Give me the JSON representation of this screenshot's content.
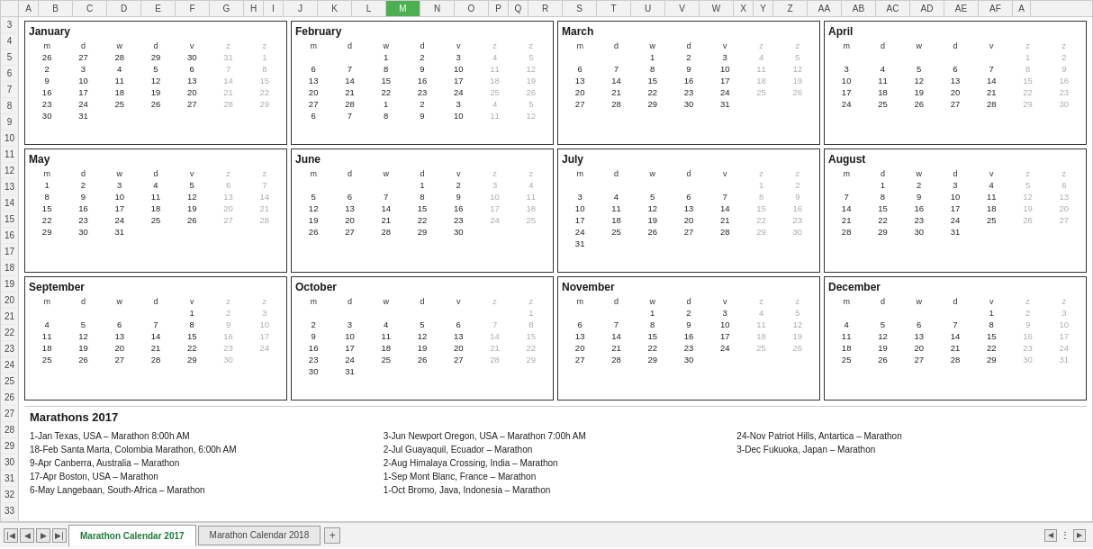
{
  "title": "Marathon Calendar 2017",
  "tabs": {
    "active": "Marathon Calendar 2017",
    "inactive": "Marathon Calendar 2018",
    "add_label": "+"
  },
  "col_headers": [
    "A",
    "B",
    "C",
    "D",
    "E",
    "F",
    "G",
    "H",
    "I",
    "J",
    "K",
    "L",
    "M",
    "N",
    "O",
    "P",
    "Q",
    "R",
    "S",
    "T",
    "U",
    "V",
    "W",
    "X",
    "Y",
    "Z",
    "AA",
    "AB",
    "AC",
    "AD",
    "AE",
    "AF",
    "A"
  ],
  "months": [
    {
      "name": "January",
      "days_header": [
        "m",
        "d",
        "w",
        "d",
        "v",
        "z",
        "z"
      ],
      "weeks": [
        [
          "26",
          "27",
          "28",
          "29",
          "30",
          "31",
          "1"
        ],
        [
          "2",
          "3",
          "4",
          "5",
          "6",
          "7",
          "8"
        ],
        [
          "9",
          "10",
          "11",
          "12",
          "13",
          "14",
          "15"
        ],
        [
          "16",
          "17",
          "18",
          "19",
          "20",
          "21",
          "22"
        ],
        [
          "23",
          "24",
          "25",
          "26",
          "27",
          "28",
          "29"
        ],
        [
          "30",
          "31",
          "",
          "",
          "",
          "",
          ""
        ]
      ],
      "weekends": [
        6,
        7
      ]
    },
    {
      "name": "February",
      "days_header": [
        "m",
        "d",
        "w",
        "d",
        "v",
        "z",
        "z"
      ],
      "weeks": [
        [
          "",
          "",
          "1",
          "2",
          "3",
          "4",
          "5"
        ],
        [
          "6",
          "7",
          "8",
          "9",
          "10",
          "11",
          "12"
        ],
        [
          "13",
          "14",
          "15",
          "16",
          "17",
          "18",
          "19"
        ],
        [
          "20",
          "21",
          "22",
          "23",
          "24",
          "25",
          "26"
        ],
        [
          "27",
          "28",
          "1",
          "2",
          "3",
          "4",
          "5"
        ],
        [
          "6",
          "7",
          "8",
          "9",
          "10",
          "11",
          "12"
        ]
      ],
      "weekends": [
        6,
        7
      ]
    },
    {
      "name": "March",
      "days_header": [
        "m",
        "d",
        "w",
        "d",
        "v",
        "z",
        "z"
      ],
      "weeks": [
        [
          "",
          "",
          "1",
          "2",
          "3",
          "4",
          "5"
        ],
        [
          "6",
          "7",
          "8",
          "9",
          "10",
          "11",
          "12"
        ],
        [
          "13",
          "14",
          "15",
          "16",
          "17",
          "18",
          "19"
        ],
        [
          "20",
          "21",
          "22",
          "23",
          "24",
          "25",
          "26"
        ],
        [
          "27",
          "28",
          "29",
          "30",
          "31",
          "",
          ""
        ]
      ],
      "weekends": [
        6,
        7
      ]
    },
    {
      "name": "April",
      "days_header": [
        "m",
        "d",
        "w",
        "d",
        "v",
        "z",
        "z"
      ],
      "weeks": [
        [
          "",
          "",
          "",
          "",
          "",
          "1",
          "2"
        ],
        [
          "3",
          "4",
          "5",
          "6",
          "7",
          "8",
          "9"
        ],
        [
          "10",
          "11",
          "12",
          "13",
          "14",
          "15",
          "16"
        ],
        [
          "17",
          "18",
          "19",
          "20",
          "21",
          "22",
          "23"
        ],
        [
          "24",
          "25",
          "26",
          "27",
          "28",
          "29",
          "30"
        ]
      ],
      "weekends": [
        6,
        7
      ]
    },
    {
      "name": "May",
      "days_header": [
        "m",
        "d",
        "w",
        "d",
        "v",
        "z",
        "z"
      ],
      "weeks": [
        [
          "1",
          "2",
          "3",
          "4",
          "5",
          "6",
          "7"
        ],
        [
          "8",
          "9",
          "10",
          "11",
          "12",
          "13",
          "14"
        ],
        [
          "15",
          "16",
          "17",
          "18",
          "19",
          "20",
          "21"
        ],
        [
          "22",
          "23",
          "24",
          "25",
          "26",
          "27",
          "28"
        ],
        [
          "29",
          "30",
          "31",
          "",
          "",
          "",
          ""
        ]
      ],
      "weekends": [
        6,
        7
      ]
    },
    {
      "name": "June",
      "days_header": [
        "m",
        "d",
        "w",
        "d",
        "v",
        "z",
        "z"
      ],
      "weeks": [
        [
          "",
          "",
          "",
          "1",
          "2",
          "3",
          "4"
        ],
        [
          "5",
          "6",
          "7",
          "8",
          "9",
          "10",
          "11"
        ],
        [
          "12",
          "13",
          "14",
          "15",
          "16",
          "17",
          "18"
        ],
        [
          "19",
          "20",
          "21",
          "22",
          "23",
          "24",
          "25"
        ],
        [
          "26",
          "27",
          "28",
          "29",
          "30",
          "",
          ""
        ]
      ],
      "weekends": [
        6,
        7
      ]
    },
    {
      "name": "July",
      "days_header": [
        "m",
        "d",
        "w",
        "d",
        "v",
        "z",
        "z"
      ],
      "weeks": [
        [
          "",
          "",
          "",
          "",
          "",
          "1",
          "2"
        ],
        [
          "3",
          "4",
          "5",
          "6",
          "7",
          "8",
          "9"
        ],
        [
          "10",
          "11",
          "12",
          "13",
          "14",
          "15",
          "16"
        ],
        [
          "17",
          "18",
          "19",
          "20",
          "21",
          "22",
          "23"
        ],
        [
          "24",
          "25",
          "26",
          "27",
          "28",
          "29",
          "30"
        ],
        [
          "31",
          "",
          "",
          "",
          "",
          "",
          ""
        ]
      ],
      "weekends": [
        6,
        7
      ]
    },
    {
      "name": "August",
      "days_header": [
        "m",
        "d",
        "w",
        "d",
        "v",
        "z",
        "z"
      ],
      "weeks": [
        [
          "",
          "1",
          "2",
          "3",
          "4",
          "5",
          "6"
        ],
        [
          "7",
          "8",
          "9",
          "10",
          "11",
          "12",
          "13"
        ],
        [
          "14",
          "15",
          "16",
          "17",
          "18",
          "19",
          "20"
        ],
        [
          "21",
          "22",
          "23",
          "24",
          "25",
          "26",
          "27"
        ],
        [
          "28",
          "29",
          "30",
          "31",
          "",
          "",
          ""
        ]
      ],
      "weekends": [
        6,
        7
      ]
    },
    {
      "name": "September",
      "days_header": [
        "m",
        "d",
        "w",
        "d",
        "v",
        "z",
        "z"
      ],
      "weeks": [
        [
          "",
          "",
          "",
          "",
          "1",
          "2",
          "3"
        ],
        [
          "4",
          "5",
          "6",
          "7",
          "8",
          "9",
          "10"
        ],
        [
          "11",
          "12",
          "13",
          "14",
          "15",
          "16",
          "17"
        ],
        [
          "18",
          "19",
          "20",
          "21",
          "22",
          "23",
          "24"
        ],
        [
          "25",
          "26",
          "27",
          "28",
          "29",
          "30",
          ""
        ]
      ],
      "weekends": [
        6,
        7
      ]
    },
    {
      "name": "October",
      "days_header": [
        "m",
        "d",
        "w",
        "d",
        "v",
        "z",
        "z"
      ],
      "weeks": [
        [
          "",
          "",
          "",
          "",
          "",
          "",
          "1"
        ],
        [
          "2",
          "3",
          "4",
          "5",
          "6",
          "7",
          "8"
        ],
        [
          "9",
          "10",
          "11",
          "12",
          "13",
          "14",
          "15"
        ],
        [
          "16",
          "17",
          "18",
          "19",
          "20",
          "21",
          "22"
        ],
        [
          "23",
          "24",
          "25",
          "26",
          "27",
          "28",
          "29"
        ],
        [
          "30",
          "31",
          "",
          "",
          "",
          "",
          ""
        ]
      ],
      "weekends": [
        6,
        7
      ]
    },
    {
      "name": "November",
      "days_header": [
        "m",
        "d",
        "w",
        "d",
        "v",
        "z",
        "z"
      ],
      "weeks": [
        [
          "",
          "",
          "1",
          "2",
          "3",
          "4",
          "5"
        ],
        [
          "6",
          "7",
          "8",
          "9",
          "10",
          "11",
          "12"
        ],
        [
          "13",
          "14",
          "15",
          "16",
          "17",
          "18",
          "19"
        ],
        [
          "20",
          "21",
          "22",
          "23",
          "24",
          "25",
          "26"
        ],
        [
          "27",
          "28",
          "29",
          "30",
          "",
          "",
          ""
        ]
      ],
      "weekends": [
        6,
        7
      ]
    },
    {
      "name": "December",
      "days_header": [
        "m",
        "d",
        "w",
        "d",
        "v",
        "z",
        "z"
      ],
      "weeks": [
        [
          "",
          "",
          "",
          "",
          "1",
          "2",
          "3"
        ],
        [
          "4",
          "5",
          "6",
          "7",
          "8",
          "9",
          "10"
        ],
        [
          "11",
          "12",
          "13",
          "14",
          "15",
          "16",
          "17"
        ],
        [
          "18",
          "19",
          "20",
          "21",
          "22",
          "23",
          "24"
        ],
        [
          "25",
          "26",
          "27",
          "28",
          "29",
          "30",
          "31"
        ]
      ],
      "weekends": [
        6,
        7
      ]
    }
  ],
  "marathons_section": {
    "title": "Marathons 2017",
    "entries_col1": [
      "1-Jan  Texas, USA – Marathon 8:00h AM",
      "18-Feb  Santa Marta, Colombia Marathon, 6:00h AM",
      "9-Apr  Canberra, Australia – Marathon",
      "17-Apr  Boston, USA – Marathon",
      "6-May  Langebaan, South-Africa – Marathon"
    ],
    "entries_col2": [
      "3-Jun  Newport Oregon, USA – Marathon 7:00h AM",
      "2-Jul  Guayaquil, Ecuador – Marathon",
      "2-Aug  Himalaya Crossing, India – Marathon",
      "1-Sep  Mont Blanc, France – Marathon",
      "1-Oct  Bromo, Java, Indonesia – Marathon"
    ],
    "entries_col3": [
      "24-Nov  Patriot Hills, Antartica – Marathon",
      "3-Dec  Fukuoka, Japan – Marathon"
    ]
  }
}
